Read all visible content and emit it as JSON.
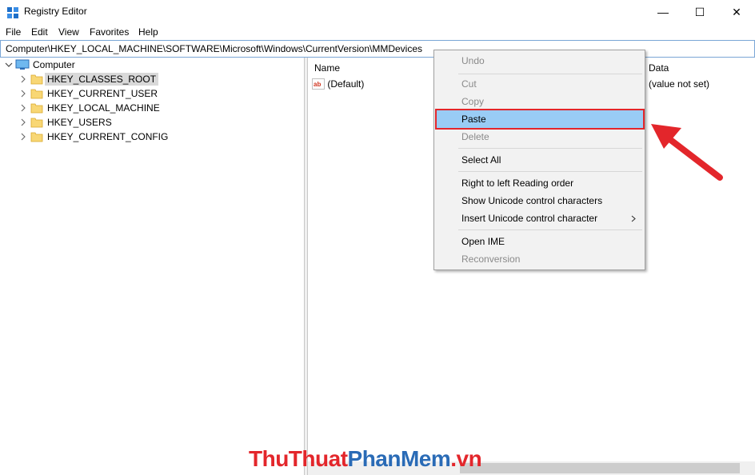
{
  "window": {
    "title": "Registry Editor",
    "minimize_glyph": "—",
    "maximize_glyph": "☐",
    "close_glyph": "✕",
    "icon": "registry-icon"
  },
  "menu": [
    "File",
    "Edit",
    "View",
    "Favorites",
    "Help"
  ],
  "address": "Computer\\HKEY_LOCAL_MACHINE\\SOFTWARE\\Microsoft\\Windows\\CurrentVersion\\MMDevices",
  "tree": {
    "root": "Computer",
    "items": [
      "HKEY_CLASSES_ROOT",
      "HKEY_CURRENT_USER",
      "HKEY_LOCAL_MACHINE",
      "HKEY_USERS",
      "HKEY_CURRENT_CONFIG"
    ],
    "selected_index": 0
  },
  "list": {
    "columns": {
      "name": "Name",
      "data": "Data"
    },
    "rows": [
      {
        "name": "(Default)",
        "data": "(value not set)",
        "icon": "string-value-icon"
      }
    ]
  },
  "context_menu": {
    "undo": "Undo",
    "cut": "Cut",
    "copy": "Copy",
    "paste": "Paste",
    "delete": "Delete",
    "select_all": "Select All",
    "rtl": "Right to left Reading order",
    "show_unicode": "Show Unicode control characters",
    "insert_unicode": "Insert Unicode control character",
    "open_ime": "Open IME",
    "reconversion": "Reconversion",
    "highlighted": "Paste"
  },
  "watermark": {
    "part1": "ThuThuat",
    "part2": "PhanMem",
    "part3": ".vn"
  },
  "colors": {
    "accent_red": "#e3262b",
    "highlight_blue": "#99ccf5",
    "folder": "#f8d775",
    "watermark_blue": "#2a6bb6"
  }
}
